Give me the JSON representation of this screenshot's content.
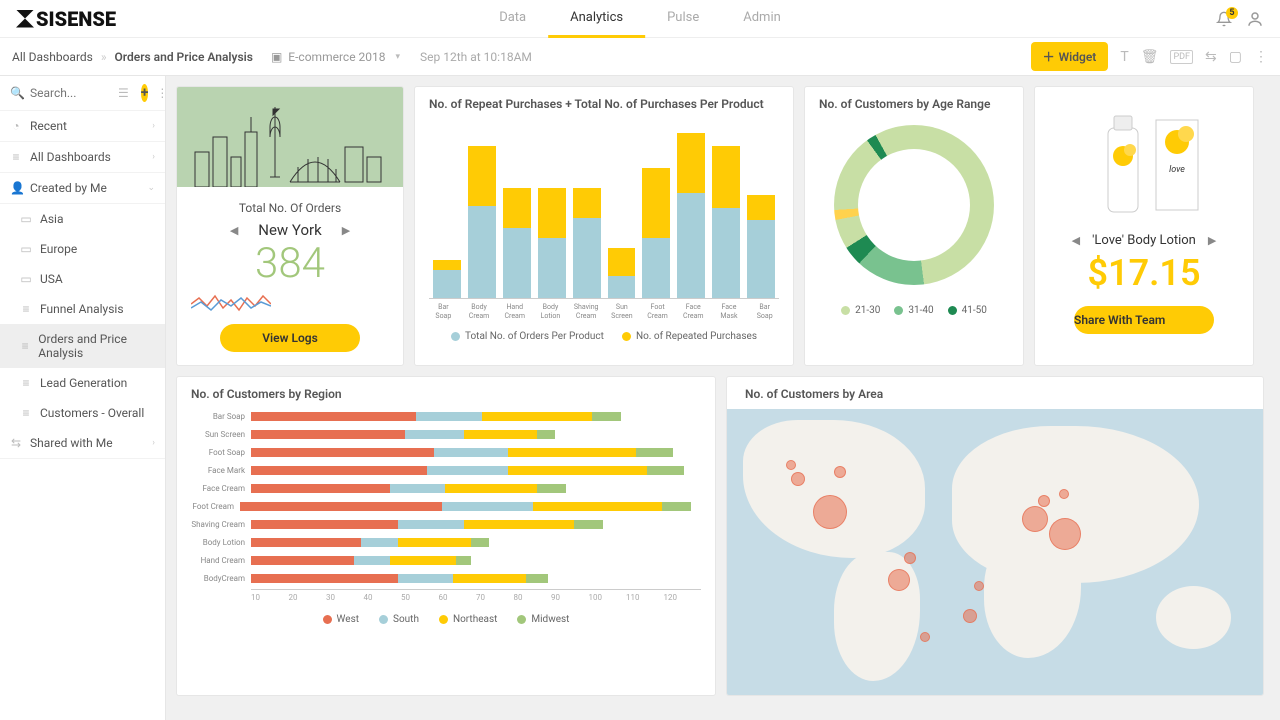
{
  "nav": {
    "tabs": [
      "Data",
      "Analytics",
      "Pulse",
      "Admin"
    ],
    "active": 1,
    "bell_count": "5"
  },
  "breadcrumb": {
    "root": "All Dashboards",
    "current": "Orders and Price Analysis",
    "dataset": "E-commerce 2018",
    "timestamp": "Sep 12th at 10:18AM",
    "widget_btn": "Widget"
  },
  "sidebar": {
    "search_placeholder": "Search...",
    "recent": "Recent",
    "all": "All Dashboards",
    "created": "Created by Me",
    "dashboards": [
      "Asia",
      "Europe",
      "USA",
      "Funnel Analysis",
      "Orders and Price Analysis",
      "Lead Generation",
      "Customers - Overall"
    ],
    "active_index": 4,
    "shared": "Shared with Me"
  },
  "orders": {
    "title": "Total No. Of Orders",
    "city": "New York",
    "value": "384",
    "btn": "View Logs"
  },
  "bar_title": "No. of Repeat Purchases + Total No. of Purchases Per Product",
  "bar_legend": {
    "a": "Total No. of Orders Per Product",
    "b": "No. of Repeated Purchases"
  },
  "donut_title": "No. of Customers by Age Range",
  "donut_legend": [
    "21-30",
    "31-40",
    "41-50"
  ],
  "product": {
    "name": "'Love' Body Lotion",
    "price": "$17.15",
    "btn": "Share With Team"
  },
  "region_title": "No. of Customers by Region",
  "region_legend": [
    "West",
    "South",
    "Northeast",
    "Midwest"
  ],
  "map_title": "No. of Customers by Area",
  "chart_data": [
    {
      "type": "bar",
      "title": "No. of Repeat Purchases + Total No. of Purchases Per Product",
      "stacked": true,
      "categories": [
        "Bar Soap",
        "Body Cream",
        "Hand Cream",
        "Body Lotion",
        "Shaving Cream",
        "Sun Screen",
        "Foot Cream",
        "Face Cream",
        "Face Mask",
        "Bar Soap"
      ],
      "series": [
        {
          "name": "Total No. of Orders Per Product",
          "values": [
            28,
            92,
            70,
            60,
            80,
            22,
            60,
            105,
            90,
            78
          ]
        },
        {
          "name": "No. of Repeated Purchases",
          "values": [
            10,
            60,
            40,
            50,
            30,
            28,
            70,
            60,
            62,
            25
          ]
        }
      ]
    },
    {
      "type": "pie",
      "title": "No. of Customers by Age Range",
      "categories": [
        "21-30",
        "31-40",
        "41-50"
      ],
      "values": [
        70,
        20,
        10
      ]
    },
    {
      "type": "bar",
      "orientation": "horizontal",
      "stacked": true,
      "title": "No. of Customers by Region",
      "categories": [
        "Bar Soap",
        "Sun Screen",
        "Foot Soap",
        "Face Mark",
        "Face Cream",
        "Foot Cream",
        "Shaving Cream",
        "Body Lotion",
        "Hand Cream",
        "BodyCream"
      ],
      "series": [
        {
          "name": "West",
          "values": [
            45,
            42,
            50,
            48,
            38,
            55,
            40,
            30,
            28,
            40
          ]
        },
        {
          "name": "South",
          "values": [
            18,
            16,
            20,
            22,
            15,
            25,
            18,
            10,
            10,
            15
          ]
        },
        {
          "name": "Northeast",
          "values": [
            30,
            20,
            35,
            38,
            25,
            35,
            30,
            20,
            18,
            20
          ]
        },
        {
          "name": "Midwest",
          "values": [
            8,
            5,
            10,
            10,
            8,
            8,
            8,
            5,
            4,
            6
          ]
        }
      ],
      "xlim": [
        0,
        120
      ],
      "xticks": [
        10,
        20,
        30,
        40,
        50,
        60,
        70,
        80,
        90,
        100,
        110,
        120
      ]
    }
  ]
}
